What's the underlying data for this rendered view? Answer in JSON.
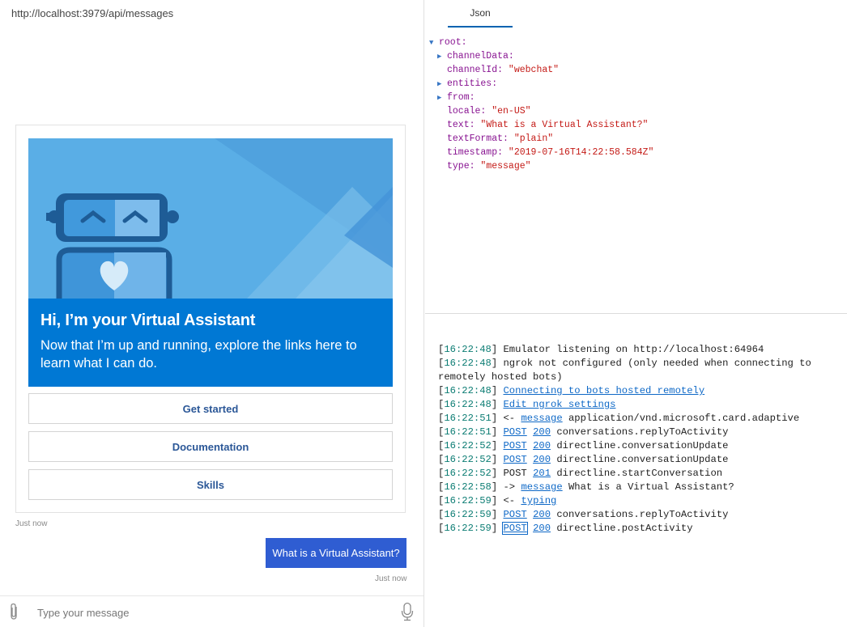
{
  "left": {
    "endpoint_url": "http://localhost:3979/api/messages",
    "card": {
      "title_pre": "Hi, I’m ",
      "title_bold": "your",
      "title_post": " Virtual Assistant",
      "body": "Now that I’m up and running, explore the links here to learn what I can do.",
      "buttons": [
        "Get started",
        "Documentation",
        "Skills"
      ],
      "timestamp": "Just now"
    },
    "user_message": {
      "text": "What is a Virtual Assistant?",
      "timestamp": "Just now"
    },
    "input": {
      "placeholder": "Type your message"
    }
  },
  "inspector": {
    "tab": "Json",
    "tree": [
      {
        "key": "root",
        "value": "",
        "arrow": "down",
        "indent": 0
      },
      {
        "key": "channelData",
        "value": "",
        "arrow": "right",
        "indent": 1
      },
      {
        "key": "channelId",
        "value": "\"webchat\"",
        "arrow": "",
        "indent": 1
      },
      {
        "key": "entities",
        "value": "",
        "arrow": "right",
        "indent": 1
      },
      {
        "key": "from",
        "value": "",
        "arrow": "right",
        "indent": 1
      },
      {
        "key": "locale",
        "value": "\"en-US\"",
        "arrow": "",
        "indent": 1
      },
      {
        "key": "text",
        "value": "\"What is a Virtual Assistant?\"",
        "arrow": "",
        "indent": 1
      },
      {
        "key": "textFormat",
        "value": "\"plain\"",
        "arrow": "",
        "indent": 1
      },
      {
        "key": "timestamp",
        "value": "\"2019-07-16T14:22:58.584Z\"",
        "arrow": "",
        "indent": 1
      },
      {
        "key": "type",
        "value": "\"message\"",
        "arrow": "",
        "indent": 1
      }
    ]
  },
  "log": [
    {
      "time": "16:22:48",
      "parts": [
        {
          "t": "Emulator listening on http://localhost:64964"
        }
      ]
    },
    {
      "time": "16:22:48",
      "parts": [
        {
          "t": "ngrok not configured (only needed when connecting to remotely hosted bots)"
        }
      ]
    },
    {
      "time": "16:22:48",
      "parts": [
        {
          "t": "Connecting to bots hosted remotely",
          "link": true
        }
      ]
    },
    {
      "time": "16:22:48",
      "parts": [
        {
          "t": "Edit ngrok settings",
          "link": true
        }
      ]
    },
    {
      "time": "16:22:51",
      "parts": [
        {
          "t": "<- "
        },
        {
          "t": "message",
          "link": true
        },
        {
          "t": " application/vnd.microsoft.card.adaptive"
        }
      ]
    },
    {
      "time": "16:22:51",
      "parts": [
        {
          "t": "POST",
          "link": true
        },
        {
          "t": " "
        },
        {
          "t": "200",
          "link": true
        },
        {
          "t": " conversations.replyToActivity"
        }
      ]
    },
    {
      "time": "16:22:52",
      "parts": [
        {
          "t": "POST",
          "link": true
        },
        {
          "t": " "
        },
        {
          "t": "200",
          "link": true
        },
        {
          "t": " directline.conversationUpdate"
        }
      ]
    },
    {
      "time": "16:22:52",
      "parts": [
        {
          "t": "POST",
          "link": true
        },
        {
          "t": " "
        },
        {
          "t": "200",
          "link": true
        },
        {
          "t": " directline.conversationUpdate"
        }
      ]
    },
    {
      "time": "16:22:52",
      "parts": [
        {
          "t": "POST "
        },
        {
          "t": "201",
          "link": true
        },
        {
          "t": " directline.startConversation"
        }
      ]
    },
    {
      "time": "16:22:58",
      "parts": [
        {
          "t": "-> "
        },
        {
          "t": "message",
          "link": true
        },
        {
          "t": " What is a Virtual Assistant?"
        }
      ]
    },
    {
      "time": "16:22:59",
      "parts": [
        {
          "t": "<- "
        },
        {
          "t": "typing",
          "link": true
        }
      ]
    },
    {
      "time": "16:22:59",
      "parts": [
        {
          "t": "POST",
          "link": true
        },
        {
          "t": " "
        },
        {
          "t": "200",
          "link": true
        },
        {
          "t": " conversations.replyToActivity"
        }
      ]
    },
    {
      "time": "16:22:59",
      "parts": [
        {
          "t": "POST",
          "link": true,
          "boxed": true
        },
        {
          "t": " "
        },
        {
          "t": "200",
          "link": true
        },
        {
          "t": " directline.postActivity"
        }
      ]
    }
  ]
}
